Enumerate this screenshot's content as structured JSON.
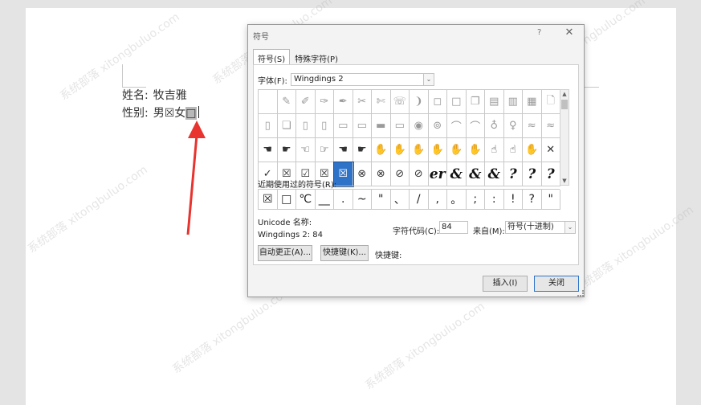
{
  "document": {
    "line1_label": "姓名:",
    "line1_value": "牧吉雅",
    "line2_label": "性别:",
    "line2_male": "男",
    "line2_male_box": "☒",
    "line2_female": "女",
    "line2_female_box": "□"
  },
  "dialog": {
    "title": "符号",
    "help": "?",
    "close": "✕",
    "tabs": [
      {
        "label": "符号(S)",
        "active": true
      },
      {
        "label": "特殊字符(P)",
        "active": false
      }
    ],
    "font_label": "字体(F):",
    "font_value": "Wingdings 2",
    "dropdown_glyph": "⌄",
    "symbols": [
      [
        "",
        "✎",
        "✐",
        "✑",
        "✒",
        "✂",
        "✄",
        "☏",
        "❩",
        "◻",
        "□",
        "❐",
        "▤",
        "▥",
        "▦",
        "🗋"
      ],
      [
        "▯",
        "❏",
        "▯",
        "▯",
        "▭",
        "▭",
        "▬",
        "▭",
        "◉",
        "⊚",
        "⌒",
        "⌒",
        "♁",
        "♀",
        "≈",
        "≈"
      ],
      [
        "☚",
        "☛",
        "☜",
        "☞",
        "☚",
        "☛",
        "✋",
        "✋",
        "✋",
        "✋",
        "✋",
        "✋",
        "☝",
        "☝",
        "✋",
        "✕"
      ],
      [
        "✓",
        "☒",
        "☑",
        "☒",
        "☒",
        "⊗",
        "⊗",
        "⊘",
        "⊘",
        "er",
        "&",
        "&",
        "&",
        "?",
        "?",
        "?"
      ]
    ],
    "selected_cell": "3-4",
    "recent_label": "近期使用过的符号(R):",
    "recent": [
      "☒",
      "□",
      "℃",
      "__",
      ".",
      "~",
      "\"",
      "、",
      "/",
      ",",
      "。",
      ";",
      ":",
      "!",
      "?",
      "\""
    ],
    "unicode_label": "Unicode 名称:",
    "unicode_value": "Wingdings 2: 84",
    "code_label": "字符代码(C):",
    "code_value": "84",
    "from_label": "来自(M):",
    "from_value": "符号(十进制)",
    "autocorrect_label": "自动更正(A)...",
    "shortcut_button_label": "快捷键(K)...",
    "shortcut_key_label": "快捷键:",
    "insert_label": "插入(I)",
    "close_label": "关闭"
  },
  "watermark": "系统部落 xitongbuluo.com",
  "colors": {
    "selection_blue": "#2f73c9",
    "arrow_red": "#e8332e"
  }
}
